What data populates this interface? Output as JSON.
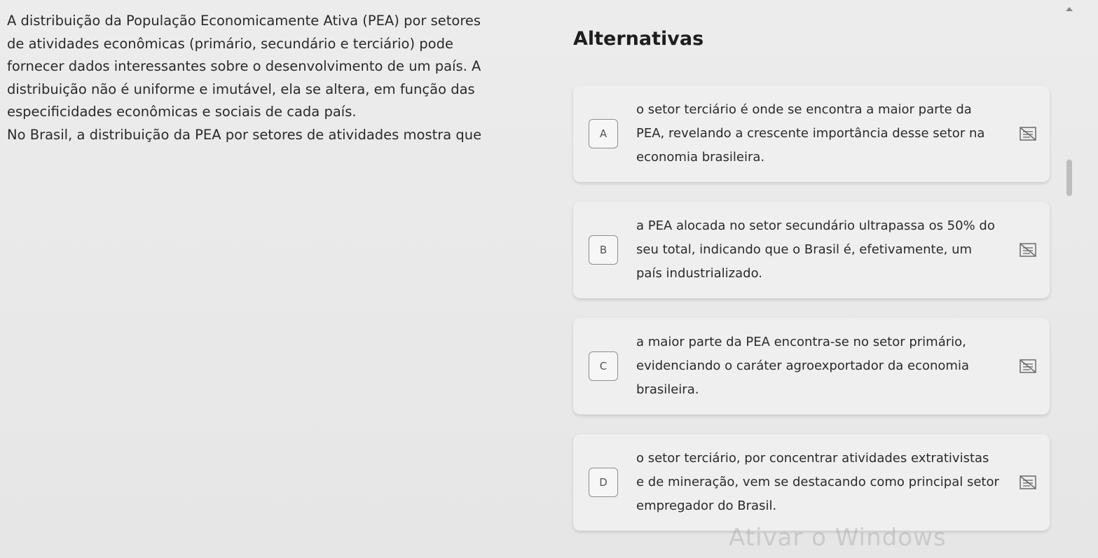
{
  "question": {
    "lines": [
      "A distribuição da População Economicamente Ativa (PEA) por setores",
      "de atividades econômicas (primário, secundário e terciário) pode",
      "fornecer dados interessantes sobre o desenvolvimento de um país. A",
      "distribuição não é uniforme e imutável, ela se altera, em função das",
      "especificidades econômicas e sociais de cada país.",
      "No Brasil, a distribuição da PEA por setores de atividades mostra que"
    ]
  },
  "alternatives": {
    "title": "Alternativas",
    "items": [
      {
        "letter": "A",
        "text": "o setor terciário é onde se encontra a maior parte da PEA, revelando a crescente importância desse setor na economia brasileira."
      },
      {
        "letter": "B",
        "text": "a PEA alocada no setor secundário ultrapassa os 50% do seu total, indicando que o Brasil é, efetivamente, um país industrializado."
      },
      {
        "letter": "C",
        "text": "a maior parte da PEA encontra-se no setor primário, evidenciando o caráter agroexportador da economia brasileira."
      },
      {
        "letter": "D",
        "text": "o setor terciário, por concentrar atividades extrativistas e de mineração, vem se destacando como principal setor empregador do Brasil."
      }
    ]
  },
  "icons": {
    "strike": "strikethrough-icon",
    "scroll_up": "scroll-up-arrow-icon"
  },
  "watermark": "Ativar o Windows",
  "colors": {
    "background": "#eaeaea",
    "card": "#efefef",
    "text": "#2a2a2a"
  }
}
